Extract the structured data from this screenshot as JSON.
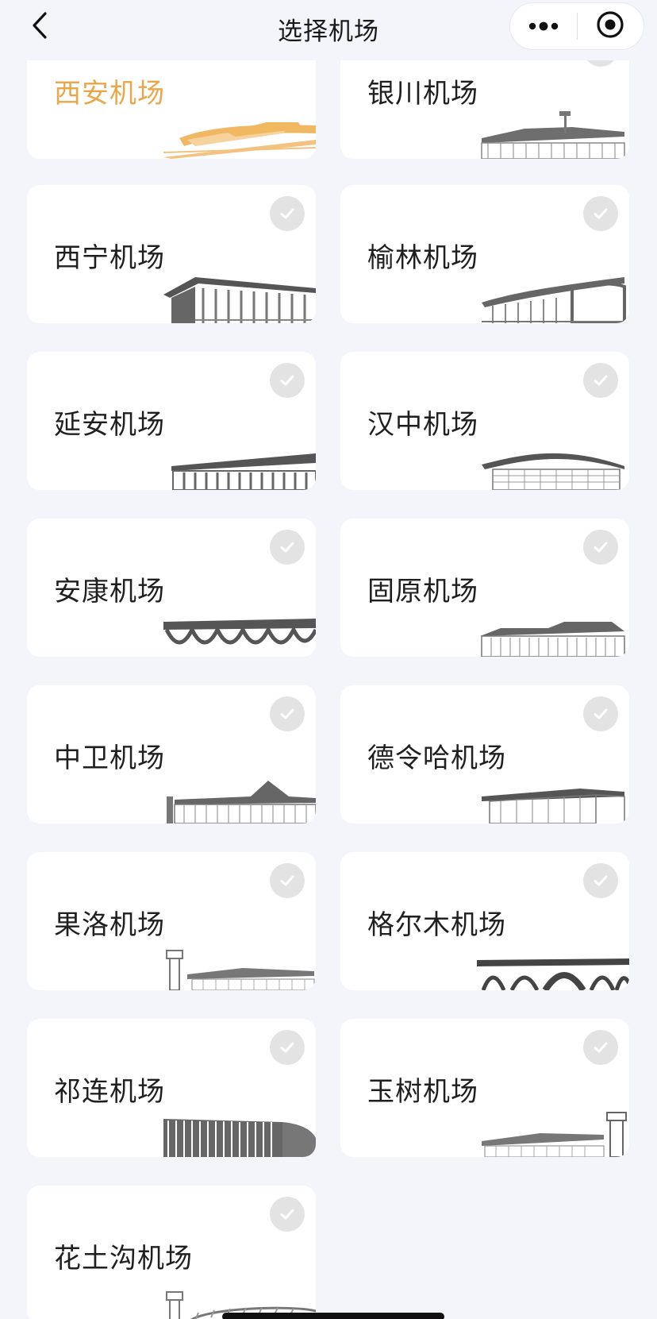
{
  "nav": {
    "title": "选择机场",
    "back_icon": "chevron-left-icon",
    "more_icon": "more-dots-icon",
    "close_icon": "record-target-icon"
  },
  "colors": {
    "background": "#f3f5fa",
    "selected_accent": "#e9a74b",
    "card": "#ffffff",
    "check_inactive": "#e3e3e3"
  },
  "airports": [
    {
      "name": "西安机场",
      "selected": true
    },
    {
      "name": "银川机场",
      "selected": false
    },
    {
      "name": "西宁机场",
      "selected": false
    },
    {
      "name": "榆林机场",
      "selected": false
    },
    {
      "name": "延安机场",
      "selected": false
    },
    {
      "name": "汉中机场",
      "selected": false
    },
    {
      "name": "安康机场",
      "selected": false
    },
    {
      "name": "固原机场",
      "selected": false
    },
    {
      "name": "中卫机场",
      "selected": false
    },
    {
      "name": "德令哈机场",
      "selected": false
    },
    {
      "name": "果洛机场",
      "selected": false
    },
    {
      "name": "格尔木机场",
      "selected": false
    },
    {
      "name": "祁连机场",
      "selected": false
    },
    {
      "name": "玉树机场",
      "selected": false
    },
    {
      "name": "花土沟机场",
      "selected": false
    }
  ]
}
